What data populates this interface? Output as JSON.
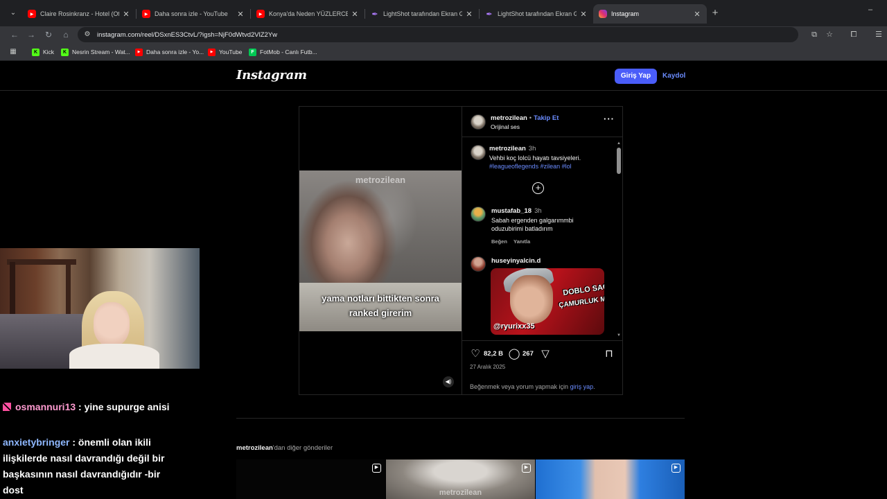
{
  "browser": {
    "tabs": [
      {
        "title": "Claire Rosinkranz - Hotel (Offici",
        "favicon": "youtube-icon"
      },
      {
        "title": "Daha sonra izle - YouTube",
        "favicon": "youtube-icon"
      },
      {
        "title": "Konya'da Neden YÜZLERCE Ol",
        "favicon": "youtube-icon"
      },
      {
        "title": "LightShot tarafından Ekran Gör",
        "favicon": "lightshot-icon"
      },
      {
        "title": "LightShot tarafından Ekran Gör",
        "favicon": "lightshot-icon"
      },
      {
        "title": "Instagram",
        "favicon": "instagram-icon"
      }
    ],
    "active_tab_index": 5,
    "url": "instagram.com/reel/DSxnES3CtvL/?igsh=NjF0dWtvd2VlZ2Yw",
    "bookmarks": [
      {
        "label": "Kick",
        "icon": "kick-icon"
      },
      {
        "label": "Nesrin Stream - Wat...",
        "icon": "kick-icon"
      },
      {
        "label": "Daha sonra izle - Yo...",
        "icon": "youtube-icon"
      },
      {
        "label": "YouTube",
        "icon": "youtube-icon"
      },
      {
        "label": "FotMob - Canlı Futb...",
        "icon": "fotmob-icon"
      }
    ]
  },
  "instagram": {
    "logo": "Instagram",
    "login_button": "Giriş Yap",
    "signup_link": "Kaydol",
    "post": {
      "video_watermark": "metrozilean",
      "video_caption_line1": "yama notları bittikten sonra",
      "video_caption_line2": "ranked girerim",
      "author": "metrozilean",
      "follow_label": "Takip Et",
      "separator": "•",
      "audio": "Orijinal ses",
      "caption": {
        "user": "metrozilean",
        "time": "3h",
        "text": "Vehbi koç lolcü hayatı tavsiyeleri.",
        "tags": "#leagueoflegends #zilean #lol"
      },
      "comments": [
        {
          "user": "mustafab_18",
          "time": "3h",
          "text_line1": "Sabah ergenden galgarımmbi",
          "text_line2": "oduzubirimi batladırım",
          "like_label": "Beğen",
          "reply_label": "Yanıtla"
        },
        {
          "user": "huseyinyalcin.d",
          "gif_text_line1": "DOBLO SAG ÖN",
          "gif_text_line2": "ÇAMURLUK MUYUZ",
          "gif_handle": "@ryurixx35"
        }
      ],
      "likes": "82,2 B",
      "comments_count": "267",
      "date": "27 Aralık 2025",
      "login_prompt_prefix": "Beğenmek veya yorum yapmak için ",
      "login_prompt_link": "giriş yap",
      "login_prompt_suffix": "."
    },
    "more_posts_user": "metrozilean",
    "more_posts_suffix": "'dan diğer gönderiler",
    "thumb_watermark": "metrozilean"
  },
  "stream_chat": [
    {
      "user": "osmannuri13",
      "message": ": yine supurge anisi"
    },
    {
      "user": "anxietybringer",
      "message": ": önemli olan ikili ilişkilerde nasıl davrandığı değil bir başkasının nasıl davrandığıdır -bir dost"
    }
  ],
  "colors": {
    "instagram_blue": "#4a5df9",
    "link_blue": "#6b8cff",
    "chat_name_pink": "#ff9bd0",
    "chat_name_blue": "#8fb8ff"
  }
}
